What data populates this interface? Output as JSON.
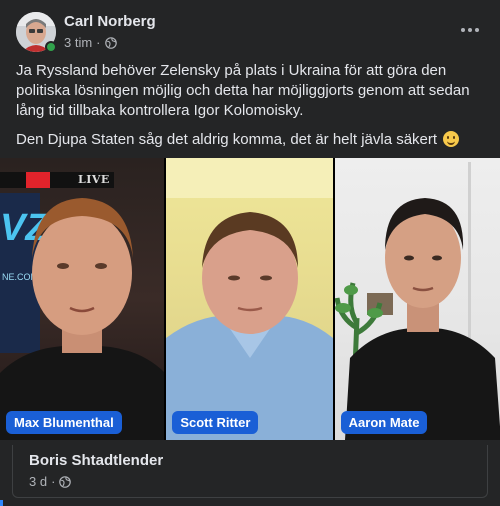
{
  "post": {
    "author": "Carl Norberg",
    "time": "3 tim",
    "separator": "·",
    "privacy_icon": "globe-icon",
    "more_icon": "more-horizontal-icon",
    "paragraphs": [
      "Ja Ryssland behöver Zelensky på plats i Ukraina för att göra den politiska lösningen möjlig och detta har möjliggjorts genom att sedan lång tid tillbaka kontrollera Igor Kolomoisky.",
      "Den Djupa Staten såg det aldrig komma, det är helt jävla säkert"
    ],
    "emoji": "slightly-smiling-face-icon"
  },
  "video": {
    "live_label": "LIVE",
    "brand_text": "VZ",
    "brand_sub": "NE.COM",
    "participants": [
      {
        "name": "Max Blumenthal"
      },
      {
        "name": "Scott Ritter"
      },
      {
        "name": "Aaron Mate"
      }
    ]
  },
  "comment": {
    "author": "Boris Shtadtlender",
    "time": "3 d",
    "separator": "·",
    "privacy_icon": "globe-icon"
  },
  "colors": {
    "background": "#242526",
    "text_primary": "#e4e6eb",
    "text_secondary": "#b0b3b8",
    "name_tag": "#1a5fd6",
    "online": "#31a24c",
    "live_red": "#e2232b"
  }
}
